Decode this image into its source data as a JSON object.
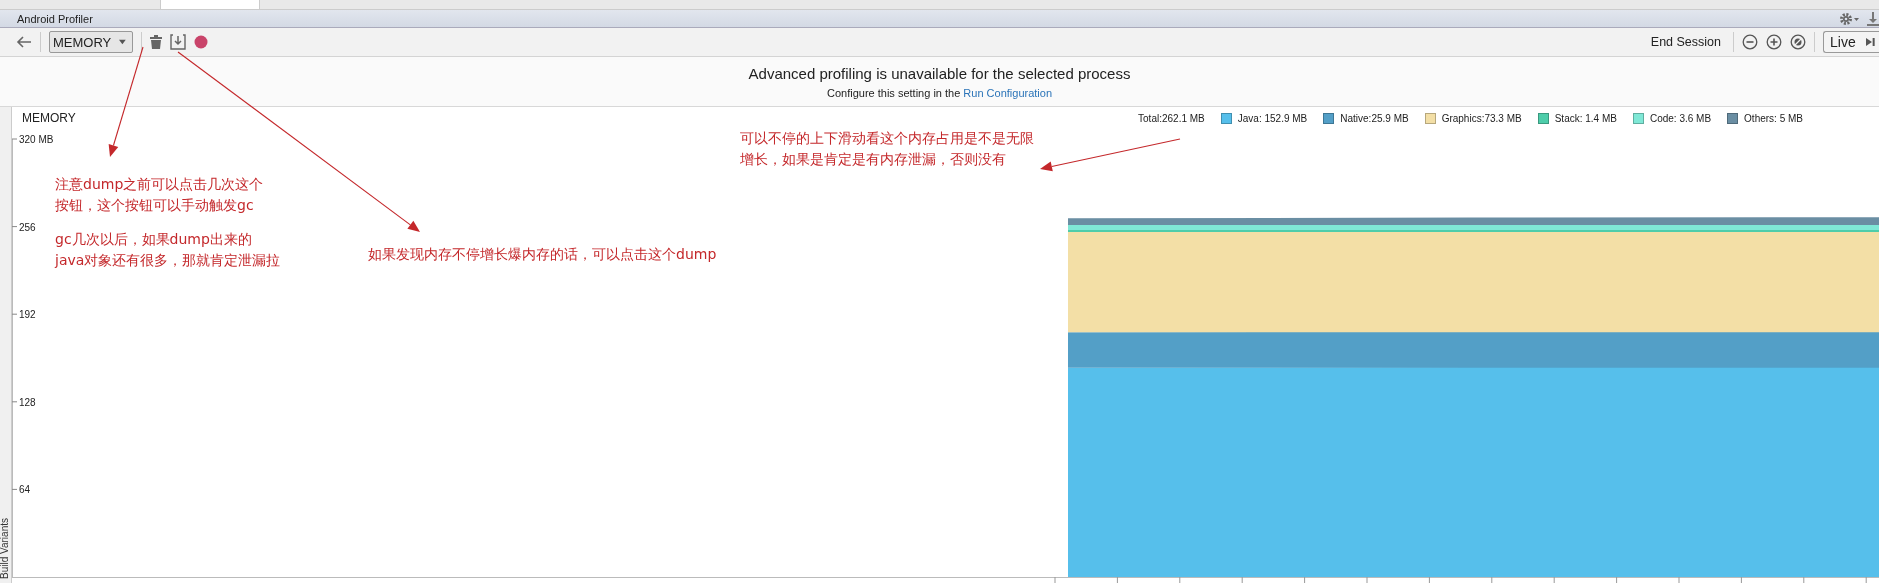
{
  "window": {
    "title": "Android Profiler"
  },
  "toolbar": {
    "monitor_select": {
      "value": "MEMORY"
    },
    "end_session": "End Session",
    "live_button": "Live"
  },
  "banner": {
    "message": "Advanced profiling is unavailable for the selected process",
    "hint": "Configure this setting in the",
    "link": "Run Configuration"
  },
  "memory": {
    "title": "MEMORY",
    "total": "Total:262.1 MB",
    "legend": [
      {
        "label": "Java: 152.9 MB",
        "color": "#56bfeb"
      },
      {
        "label": "Native:25.9 MB",
        "color": "#539fc7"
      },
      {
        "label": "Graphics:73.3 MB",
        "color": "#f3dfa6"
      },
      {
        "label": "Stack: 1.4 MB",
        "color": "#4ecdaa"
      },
      {
        "label": "Code: 3.6 MB",
        "color": "#7fe8d6"
      },
      {
        "label": "Others: 5 MB",
        "color": "#6a8ea3"
      }
    ],
    "y_axis_labels": [
      "320 MB",
      "256",
      "192",
      "128",
      "64"
    ]
  },
  "side_tab": "Build Variants",
  "annotations": [
    {
      "lines": [
        "注意dump之前可以点击几次这个",
        "按钮，这个按钮可以手动触发gc"
      ]
    },
    {
      "lines": [
        "gc几次以后，如果dump出来的",
        "java对象还有很多，那就肯定泄漏拉"
      ]
    },
    {
      "lines": [
        "如果发现内存不停增长爆内存的话，可以点击这个dump"
      ]
    },
    {
      "lines": [
        "可以不停的上下滑动看这个内存占用是不是无限",
        "增长，如果是肯定是有内存泄漏，否则没有"
      ]
    }
  ]
}
